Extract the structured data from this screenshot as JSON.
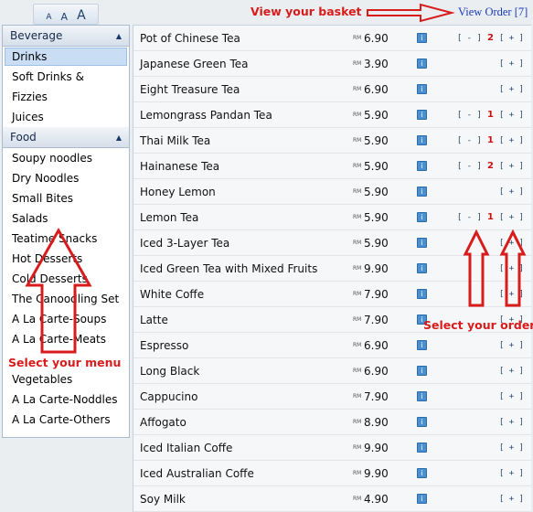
{
  "font_sizes": [
    "A",
    "A",
    "A"
  ],
  "annotations": {
    "basket": "View your basket",
    "order": "Select your order",
    "menu": "Select your menu"
  },
  "view_order": "View Order [7]",
  "currency": "RM",
  "sidebar": {
    "beverage_header": "Beverage",
    "beverage_items": [
      "Drinks",
      "Soft Drinks & Fizzies",
      "Juices"
    ],
    "food_header": "Food",
    "food_items": [
      "Soupy noodles",
      "Dry Noodles",
      "Small Bites",
      "Salads",
      "Teatime Snacks",
      "Hot Desserts",
      "Cold Desserts",
      "The Canoodling Set",
      "A La Carte-Soups",
      "A La Carte-Meats",
      "",
      "Vegetables",
      "A La Carte-Noddles",
      "A La Carte-Others"
    ]
  },
  "items": [
    {
      "name": "Pot of Chinese Tea",
      "price": "6.90",
      "qty": "2"
    },
    {
      "name": "Japanese Green Tea",
      "price": "3.90",
      "qty": ""
    },
    {
      "name": "Eight Treasure Tea",
      "price": "6.90",
      "qty": ""
    },
    {
      "name": "Lemongrass Pandan Tea",
      "price": "5.90",
      "qty": "1"
    },
    {
      "name": "Thai Milk Tea",
      "price": "5.90",
      "qty": "1"
    },
    {
      "name": "Hainanese Tea",
      "price": "5.90",
      "qty": "2"
    },
    {
      "name": "Honey Lemon",
      "price": "5.90",
      "qty": ""
    },
    {
      "name": "Lemon Tea",
      "price": "5.90",
      "qty": "1"
    },
    {
      "name": "Iced 3-Layer Tea",
      "price": "5.90",
      "qty": ""
    },
    {
      "name": "Iced Green Tea with Mixed Fruits",
      "price": "9.90",
      "qty": ""
    },
    {
      "name": "White Coffe",
      "price": "7.90",
      "qty": ""
    },
    {
      "name": "Latte",
      "price": "7.90",
      "qty": ""
    },
    {
      "name": "Espresso",
      "price": "6.90",
      "qty": ""
    },
    {
      "name": "Long Black",
      "price": "6.90",
      "qty": ""
    },
    {
      "name": "Cappucino",
      "price": "7.90",
      "qty": ""
    },
    {
      "name": "Affogato",
      "price": "8.90",
      "qty": ""
    },
    {
      "name": "Iced Italian Coffe",
      "price": "9.90",
      "qty": ""
    },
    {
      "name": "Iced Australian Coffe",
      "price": "9.90",
      "qty": ""
    },
    {
      "name": "Soy Milk",
      "price": "4.90",
      "qty": ""
    }
  ],
  "buttons": {
    "minus": "[ - ]",
    "plus": "[ + ]",
    "info": "i"
  },
  "colors": {
    "annotation": "#d81c1c",
    "link": "#1a3ab8",
    "qty": "#d01010",
    "header": "#d5dfea"
  }
}
